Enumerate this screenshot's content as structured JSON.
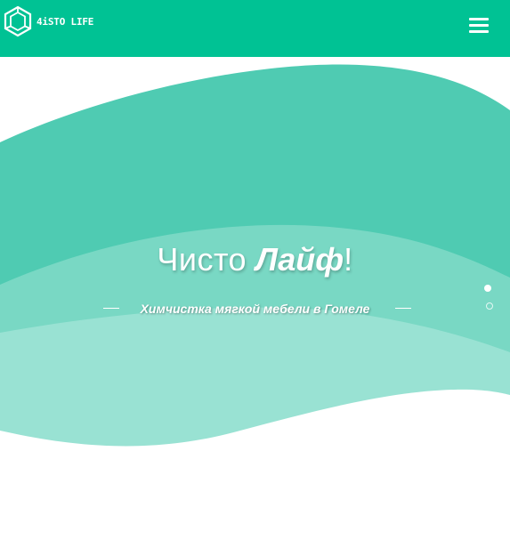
{
  "header": {
    "logo_text": "4iSTO LIFE",
    "logo_icon": "hexagon-logo-icon",
    "menu_icon": "hamburger-menu-icon"
  },
  "hero": {
    "title_thin": "Чисто",
    "title_bold": "Лайф",
    "title_exclaim": "!",
    "subtitle": "Химчистка мягкой мебели в Гомеле"
  },
  "slider": {
    "slide_count": 2,
    "active_index": 0
  },
  "colors": {
    "header": "#00c294",
    "wave_top": "#4fcbb2",
    "wave_mid": "#79d8c4",
    "wave_bottom": "#99e2d3",
    "text": "#ffffff"
  }
}
